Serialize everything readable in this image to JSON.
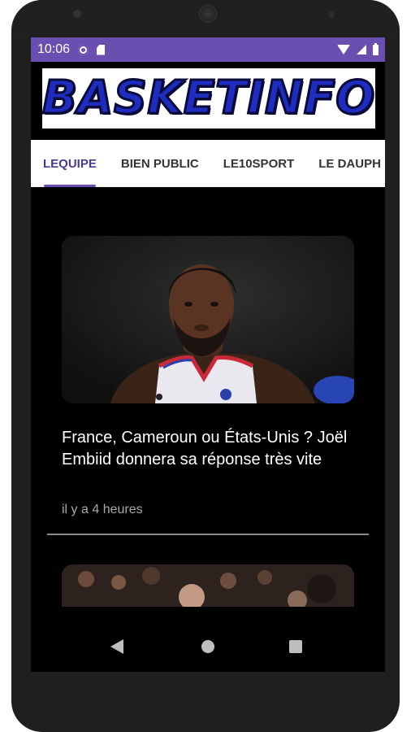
{
  "status_bar": {
    "time": "10:06",
    "icons": [
      "settings-icon",
      "sd-card-icon",
      "wifi-icon",
      "signal-icon",
      "battery-icon"
    ],
    "background_color": "#6a4fb0"
  },
  "header": {
    "logo_text": "BASKETINFO",
    "logo_color": "#1f2cc0"
  },
  "tabs": [
    {
      "label": "LEQUIPE",
      "active": true
    },
    {
      "label": "BIEN PUBLIC",
      "active": false
    },
    {
      "label": "LE10SPORT",
      "active": false
    },
    {
      "label": "LE DAUPH",
      "active": false
    }
  ],
  "feed": {
    "articles": [
      {
        "title": "France, Cameroun ou États-Unis ? Joël Embiid donnera sa réponse très vite",
        "time": "il y a 4 heures"
      }
    ]
  },
  "nav_bar": {
    "buttons": [
      "back-icon",
      "home-icon",
      "recents-icon"
    ]
  },
  "colors": {
    "accent": "#6a4fb0",
    "background": "#000000",
    "tab_text": "#333333",
    "secondary_text": "#a9a9a9"
  }
}
